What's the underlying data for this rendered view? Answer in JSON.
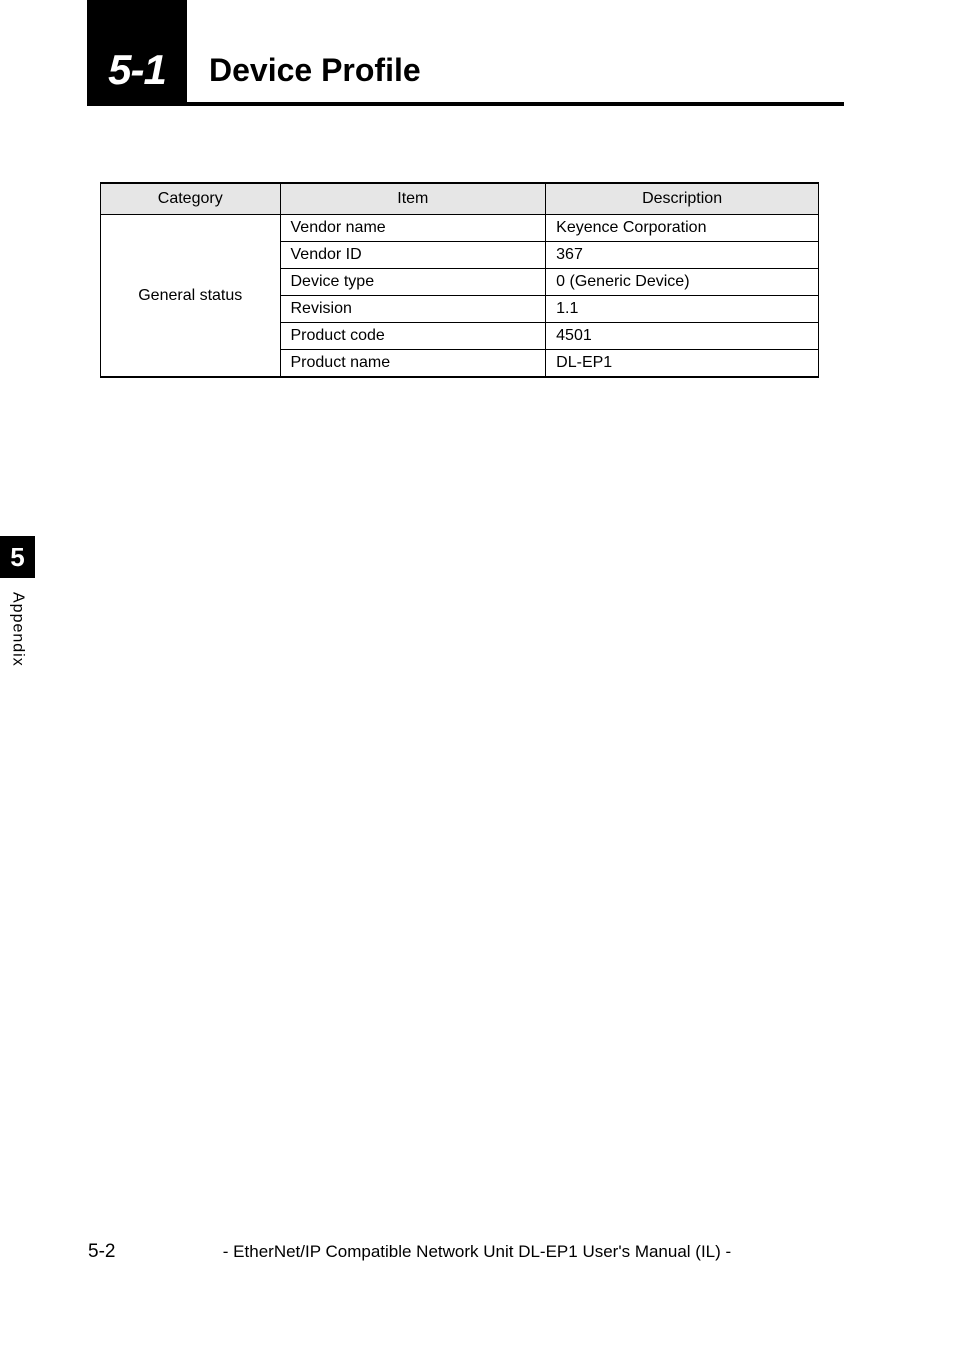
{
  "header": {
    "section_number": "5-1",
    "title": "Device Profile"
  },
  "table": {
    "columns": {
      "category": "Category",
      "item": "Item",
      "description": "Description"
    },
    "category": "General status",
    "rows": [
      {
        "item": "Vendor name",
        "description": "Keyence Corporation"
      },
      {
        "item": "Vendor ID",
        "description": "367"
      },
      {
        "item": "Device type",
        "description": "0 (Generic Device)"
      },
      {
        "item": "Revision",
        "description": "1.1"
      },
      {
        "item": "Product code",
        "description": "4501"
      },
      {
        "item": "Product name",
        "description": "DL-EP1"
      }
    ]
  },
  "side_tab": {
    "number": "5",
    "label": "Appendix"
  },
  "footer": {
    "page": "5-2",
    "title": "- EtherNet/IP Compatible Network Unit DL-EP1 User's Manual (IL) -"
  }
}
